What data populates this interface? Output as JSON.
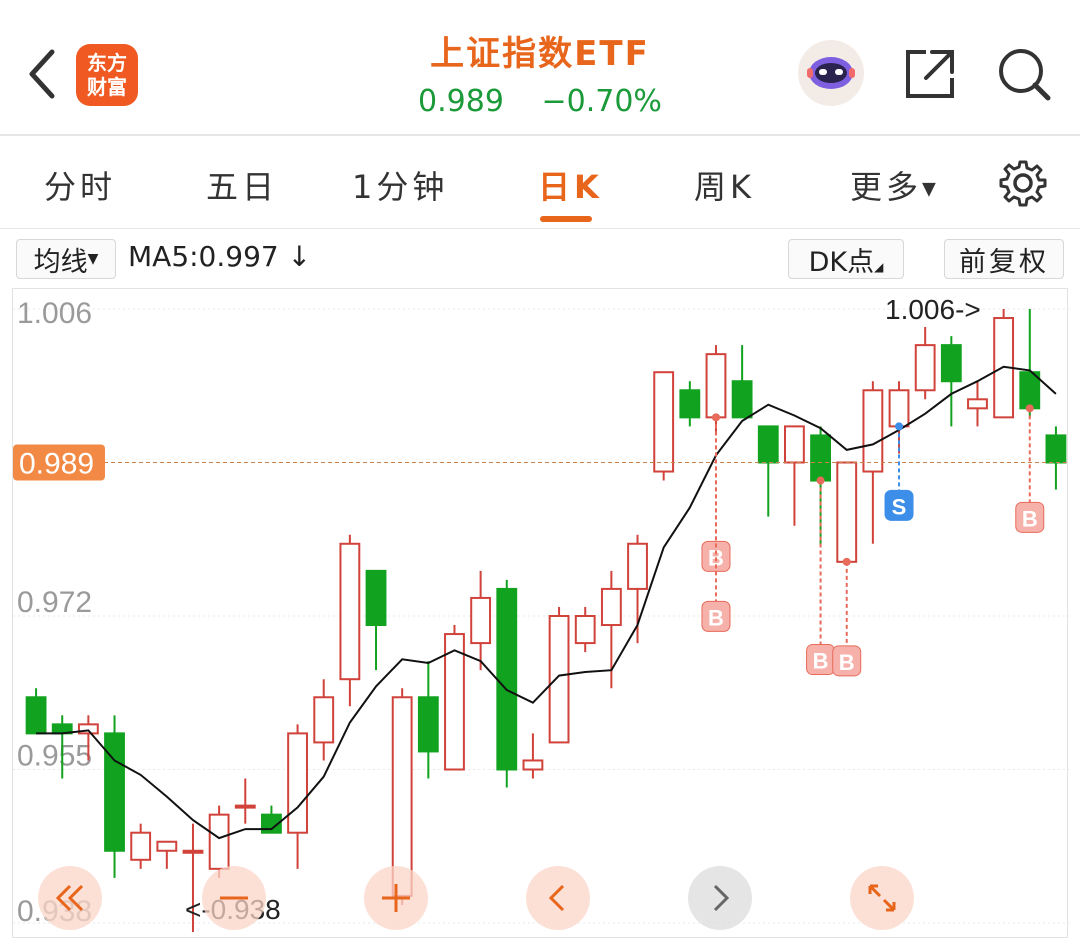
{
  "header": {
    "logo_line1": "东方",
    "logo_line2": "财富",
    "title": "上证指数ETF",
    "price": "0.989",
    "change": "−0.70%"
  },
  "tabs": [
    "分时",
    "五日",
    "1分钟",
    "日K",
    "周K",
    "更多"
  ],
  "active_tab": "日K",
  "controls": {
    "ma_select": "均线",
    "ma_value": "MA5:0.997",
    "dk_button": "DK点",
    "adjust_button": "前复权"
  },
  "chart_data": {
    "type": "candlestick",
    "y_ticks": [
      "1.006",
      "0.989",
      "0.972",
      "0.955",
      "0.938"
    ],
    "ylim": [
      0.938,
      1.006
    ],
    "current_price_label": "0.989",
    "high_label": "1.006->",
    "low_label": "<-0.938",
    "signal_labels": [
      "B",
      "B",
      "B",
      "S",
      "B",
      "B"
    ],
    "candles": [
      {
        "o": 0.963,
        "c": 0.959,
        "h": 0.964,
        "l": 0.959
      },
      {
        "o": 0.96,
        "c": 0.959,
        "h": 0.961,
        "l": 0.954
      },
      {
        "o": 0.959,
        "c": 0.96,
        "h": 0.961,
        "l": 0.956
      },
      {
        "o": 0.959,
        "c": 0.946,
        "h": 0.961,
        "l": 0.943
      },
      {
        "o": 0.945,
        "c": 0.948,
        "h": 0.949,
        "l": 0.944
      },
      {
        "o": 0.946,
        "c": 0.947,
        "h": 0.947,
        "l": 0.944
      },
      {
        "o": 0.946,
        "c": 0.946,
        "h": 0.949,
        "l": 0.937
      },
      {
        "o": 0.944,
        "c": 0.95,
        "h": 0.951,
        "l": 0.943
      },
      {
        "o": 0.951,
        "c": 0.951,
        "h": 0.954,
        "l": 0.949
      },
      {
        "o": 0.95,
        "c": 0.948,
        "h": 0.951,
        "l": 0.948
      },
      {
        "o": 0.948,
        "c": 0.959,
        "h": 0.96,
        "l": 0.944
      },
      {
        "o": 0.958,
        "c": 0.963,
        "h": 0.965,
        "l": 0.956
      },
      {
        "o": 0.965,
        "c": 0.98,
        "h": 0.981,
        "l": 0.962
      },
      {
        "o": 0.977,
        "c": 0.971,
        "h": 0.977,
        "l": 0.966
      },
      {
        "o": 0.941,
        "c": 0.963,
        "h": 0.964,
        "l": 0.94
      },
      {
        "o": 0.963,
        "c": 0.957,
        "h": 0.967,
        "l": 0.954
      },
      {
        "o": 0.955,
        "c": 0.97,
        "h": 0.971,
        "l": 0.955
      },
      {
        "o": 0.969,
        "c": 0.974,
        "h": 0.977,
        "l": 0.966
      },
      {
        "o": 0.975,
        "c": 0.955,
        "h": 0.976,
        "l": 0.953
      },
      {
        "o": 0.955,
        "c": 0.956,
        "h": 0.959,
        "l": 0.954
      },
      {
        "o": 0.958,
        "c": 0.972,
        "h": 0.973,
        "l": 0.958
      },
      {
        "o": 0.969,
        "c": 0.972,
        "h": 0.973,
        "l": 0.968
      },
      {
        "o": 0.971,
        "c": 0.975,
        "h": 0.977,
        "l": 0.964
      },
      {
        "o": 0.975,
        "c": 0.98,
        "h": 0.981,
        "l": 0.969
      },
      {
        "o": 0.988,
        "c": 0.999,
        "h": 0.999,
        "l": 0.987
      },
      {
        "o": 0.997,
        "c": 0.994,
        "h": 0.998,
        "l": 0.993
      },
      {
        "o": 0.994,
        "c": 1.001,
        "h": 1.002,
        "l": 0.992
      },
      {
        "o": 0.998,
        "c": 0.994,
        "h": 1.002,
        "l": 0.994
      },
      {
        "o": 0.993,
        "c": 0.989,
        "h": 0.993,
        "l": 0.983
      },
      {
        "o": 0.989,
        "c": 0.993,
        "h": 0.993,
        "l": 0.982
      },
      {
        "o": 0.992,
        "c": 0.987,
        "h": 0.993,
        "l": 0.98
      },
      {
        "o": 0.978,
        "c": 0.989,
        "h": 0.989,
        "l": 0.978
      },
      {
        "o": 0.988,
        "c": 0.997,
        "h": 0.998,
        "l": 0.98
      },
      {
        "o": 0.993,
        "c": 0.997,
        "h": 0.998,
        "l": 0.99
      },
      {
        "o": 0.997,
        "c": 1.002,
        "h": 1.004,
        "l": 0.996
      },
      {
        "o": 1.002,
        "c": 0.998,
        "h": 1.003,
        "l": 0.993
      },
      {
        "o": 0.995,
        "c": 0.996,
        "h": 0.998,
        "l": 0.993
      },
      {
        "o": 0.994,
        "c": 1.005,
        "h": 1.006,
        "l": 0.994
      },
      {
        "o": 0.999,
        "c": 0.995,
        "h": 1.006,
        "l": 0.994
      },
      {
        "o": 0.992,
        "c": 0.989,
        "h": 0.993,
        "l": 0.986
      }
    ]
  },
  "colors": {
    "accent": "#e8651c",
    "up": "#d0423a",
    "down": "#11a21f",
    "buy": "#e86a5a",
    "sell": "#3d8ee8"
  },
  "nav_icons": [
    "double-left-icon",
    "zoom-out-icon",
    "zoom-in-icon",
    "prev-icon",
    "next-icon",
    "fullscreen-icon"
  ]
}
